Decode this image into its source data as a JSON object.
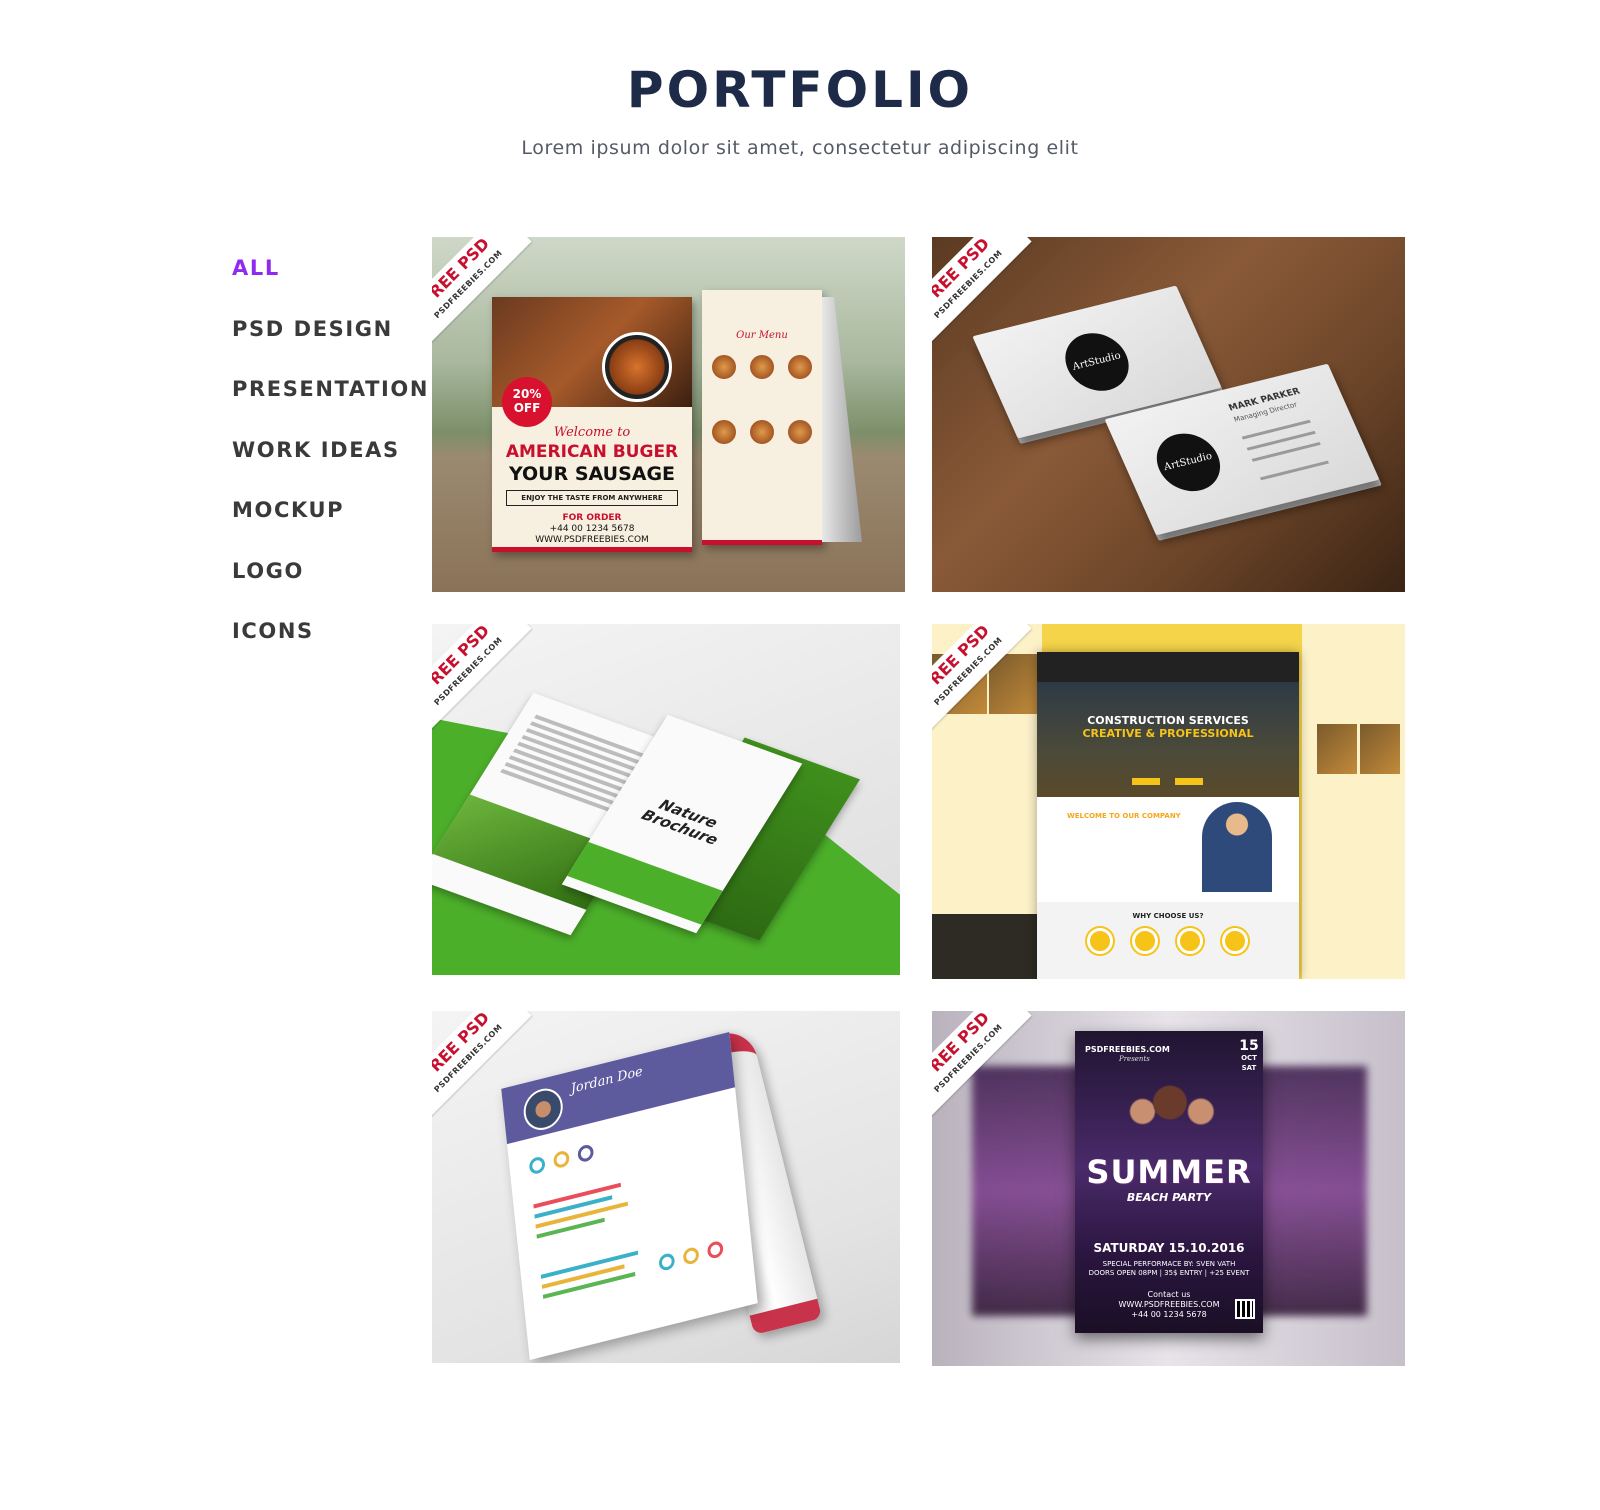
{
  "header": {
    "title": "PORTFOLIO",
    "subtitle": "Lorem ipsum dolor sit amet, consectetur adipiscing elit"
  },
  "filters": {
    "active": "ALL",
    "items": [
      "ALL",
      "PSD DESIGN",
      "PRESENTATION",
      "WORK IDEAS",
      "MOCKUP",
      "LOGO",
      "ICONS"
    ]
  },
  "ribbon": {
    "line1": "FREE PSD",
    "line2": "PSDFREEBIES.COM"
  },
  "colors": {
    "accent": "#8f2bf1",
    "title": "#1d2a48",
    "ribbon_red": "#c8102e"
  },
  "tiles": [
    {
      "name": "table-tent-menu",
      "badge": "20% OFF",
      "welcome": "Welcome to",
      "headline1": "AMERICAN BUGER",
      "headline2": "YOUR SAUSAGE",
      "enjoy": "ENJOY THE TASTE FROM ANYWHERE",
      "order_label": "FOR ORDER",
      "phone": "+44 00 1234 5678",
      "site": "WWW.PSDFREEBIES.COM",
      "menu_title": "Our Menu"
    },
    {
      "name": "business-card",
      "logo": "ArtStudio",
      "person": "MARK PARKER",
      "role": "Managing Director"
    },
    {
      "name": "trifold-brochure",
      "title": "Nature Brochure"
    },
    {
      "name": "construction-website",
      "line1": "CONSTRUCTION SERVICES",
      "line2": "CREATIVE & PROFESSIONAL",
      "welcome": "WELCOME TO OUR COMPANY",
      "why": "WHY CHOOSE US?"
    },
    {
      "name": "resume",
      "person": "Jordan Doe"
    },
    {
      "name": "summer-party-flyer",
      "brand": "PSDFREEBIES.COM",
      "presents": "Presents",
      "day": "15",
      "month": "OCT",
      "weekday": "SAT",
      "title": "SUMMER",
      "subtitle": "BEACH PARTY",
      "date_line": "SATURDAY 15.10.2016",
      "perf1": "SPECIAL PERFORMACE BY: SVEN VATH",
      "perf2": "DOORS OPEN 08PM | 35$ ENTRY | +25 EVENT",
      "contact_label": "Contact us",
      "site": "WWW.PSDFREEBIES.COM",
      "phone": "+44 00 1234 5678"
    }
  ]
}
